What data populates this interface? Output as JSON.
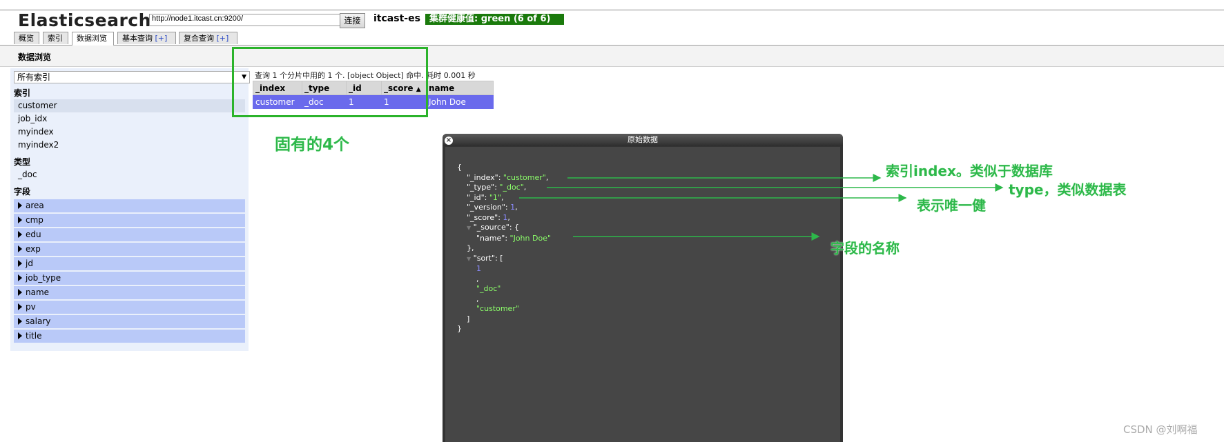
{
  "header": {
    "app_title": "Elasticsearch",
    "url_value": "http://node1.itcast.cn:9200/",
    "connect_label": "连接",
    "cluster_name": "itcast-es",
    "health_text": "集群健康值: green (6 of 6)",
    "health_color": "#1a7a0c"
  },
  "tabs": [
    {
      "label": "概览",
      "plus": ""
    },
    {
      "label": "索引",
      "plus": ""
    },
    {
      "label": "数据浏览",
      "plus": ""
    },
    {
      "label": "基本查询",
      "plus": "[+]"
    },
    {
      "label": "复合查询",
      "plus": "[+]"
    }
  ],
  "page": {
    "section_title": "数据浏览"
  },
  "sidebar": {
    "index_select_value": "所有索引",
    "indices_label": "索引",
    "indices": [
      "customer",
      "job_idx",
      "myindex",
      "myindex2"
    ],
    "types_label": "类型",
    "types": [
      "_doc"
    ],
    "fields_label": "字段",
    "fields": [
      "area",
      "cmp",
      "edu",
      "exp",
      "jd",
      "job_type",
      "name",
      "pv",
      "salary",
      "title"
    ]
  },
  "results": {
    "summary": "查询 1 个分片中用的 1 个. [object Object] 命中. 耗时 0.001 秒",
    "columns": [
      "_index",
      "_type",
      "_id",
      "_score",
      "name"
    ],
    "rows": [
      [
        "customer",
        "_doc",
        "1",
        "1",
        "John Doe"
      ]
    ]
  },
  "dialog": {
    "title": "原始数据",
    "json": {
      "index_key": "\"_index\"",
      "index_val": "\"customer\"",
      "type_key": "\"_type\"",
      "type_val": "\"_doc\"",
      "id_key": "\"_id\"",
      "id_val": "\"1\"",
      "version_key": "\"_version\"",
      "version_val": "1",
      "score_key": "\"_score\"",
      "score_val": "1",
      "source_key": "\"_source\"",
      "name_key": "\"name\"",
      "name_val": "\"John Doe\"",
      "sort_key": "\"sort\"",
      "sort_val1": "1",
      "sort_val2": "\"_doc\"",
      "sort_val3": "\"customer\""
    }
  },
  "annotations": {
    "intrinsic": "固有的4个",
    "index_note": "索引index。类似于数据库",
    "type_note": "type，类似数据表",
    "id_note": "表示唯一健",
    "field_note": "字段的名称",
    "color": "#2db84a"
  },
  "watermark": "CSDN @刘啊福"
}
